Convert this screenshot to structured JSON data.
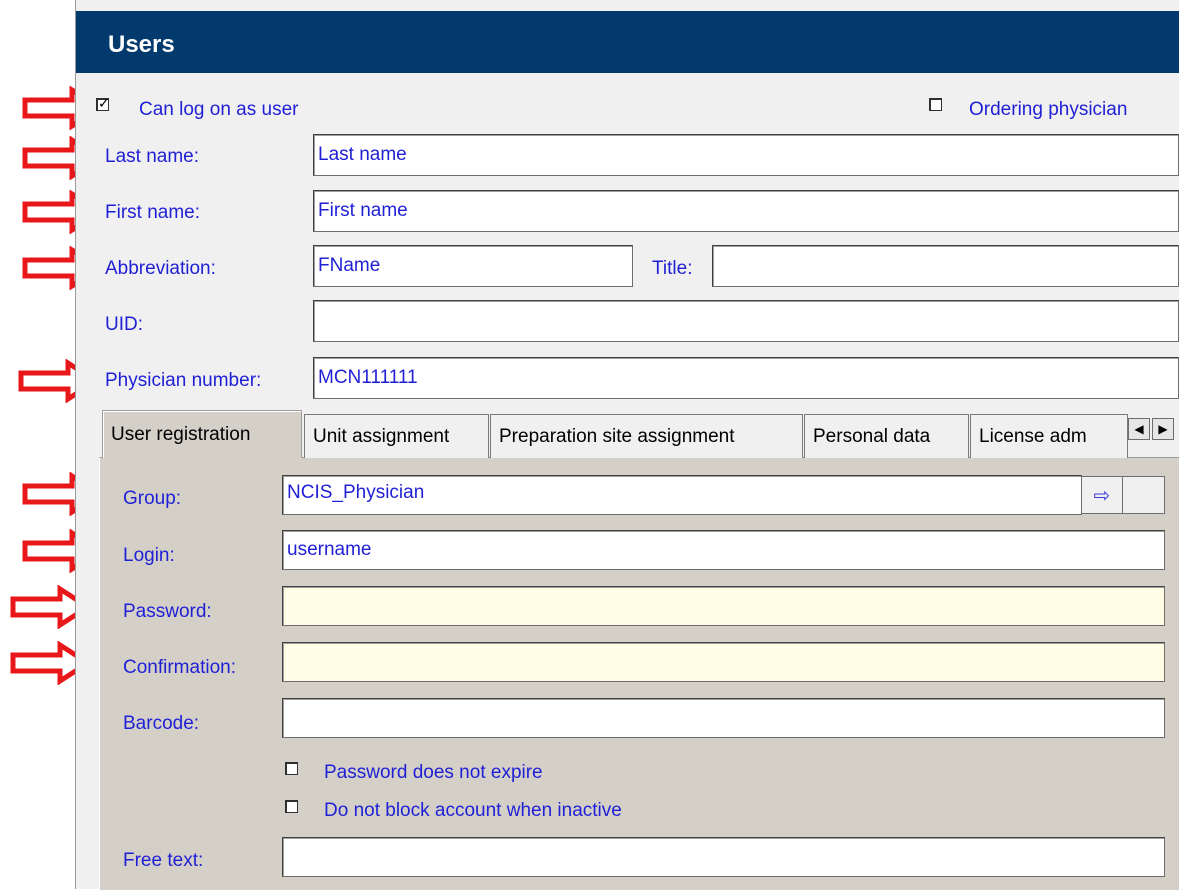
{
  "window": {
    "title": "Users"
  },
  "header_checks": {
    "can_log_on": {
      "label": "Can log on as user",
      "checked": true
    },
    "ordering_physician": {
      "label": "Ordering physician",
      "checked": false
    }
  },
  "fields": {
    "last_name": {
      "label": "Last name:",
      "value": "Last name"
    },
    "first_name": {
      "label": "First name:",
      "value": "First name"
    },
    "abbreviation": {
      "label": "Abbreviation:",
      "value": "FName"
    },
    "title": {
      "label": "Title:",
      "value": ""
    },
    "uid": {
      "label": "UID:",
      "value": ""
    },
    "physician_number": {
      "label": "Physician number:",
      "value": "MCN111111"
    }
  },
  "tabs": [
    {
      "label": "User registration",
      "active": true
    },
    {
      "label": "Unit assignment",
      "active": false
    },
    {
      "label": "Preparation site assignment",
      "active": false
    },
    {
      "label": "Personal data",
      "active": false
    },
    {
      "label": "License adm",
      "active": false
    }
  ],
  "tab_scroll": {
    "left_icon": "triangle-left-icon",
    "right_icon": "triangle-right-icon"
  },
  "registration": {
    "group": {
      "label": "Group:",
      "value": "NCIS_Physician",
      "lookup_icon": "arrow-right-icon",
      "lookup_glyph": "⇨"
    },
    "login": {
      "label": "Login:",
      "value": "username"
    },
    "password": {
      "label": "Password:",
      "value": ""
    },
    "confirmation": {
      "label": "Confirmation:",
      "value": ""
    },
    "barcode": {
      "label": "Barcode:",
      "value": ""
    },
    "password_no_expire": {
      "label": "Password does not expire",
      "checked": false
    },
    "no_block_inactive": {
      "label": "Do not block account when inactive",
      "checked": false
    },
    "free_text": {
      "label": "Free text:",
      "value": ""
    }
  },
  "annotation": {
    "icon": "red-arrow-icon",
    "color": "#e8171a"
  },
  "colors": {
    "title_bar": "#033a6e",
    "label_text": "#1f1fd6",
    "password_bg": "#fffde3",
    "panel_bg": "#d4d0c8"
  }
}
